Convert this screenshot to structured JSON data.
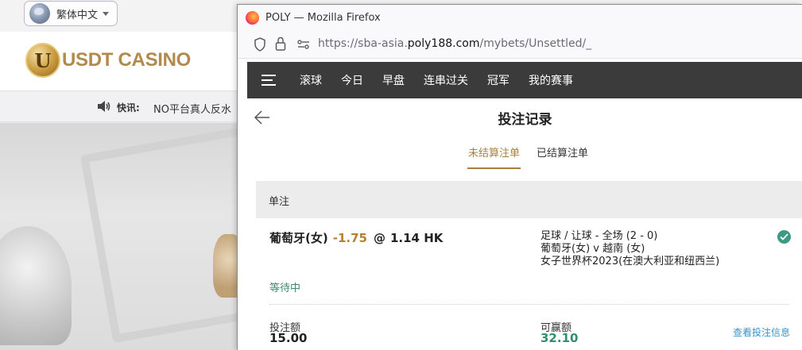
{
  "background_site": {
    "language_selector": {
      "label": "繁体中文",
      "icon": "globe-icon"
    },
    "logo": {
      "mark": "U",
      "text": "USDT CASINO"
    },
    "news": {
      "label": "快讯:",
      "text": "NO平台真人反水",
      "icon": "speaker-icon"
    }
  },
  "browser": {
    "window_title": "POLY — Mozilla Firefox",
    "url": {
      "prefix": "https://sba-asia.",
      "domain": "poly188.com",
      "path": "/mybets/Unsettled/_"
    }
  },
  "sports_nav": {
    "items": [
      {
        "label": "滚球"
      },
      {
        "label": "今日"
      },
      {
        "label": "早盘"
      },
      {
        "label": "连串过关"
      },
      {
        "label": "冠军"
      },
      {
        "label": "我的赛事"
      }
    ]
  },
  "page": {
    "title": "投注记录",
    "tabs": [
      {
        "label": "未结算注单",
        "active": true
      },
      {
        "label": "已结算注单",
        "active": false
      }
    ],
    "section_label": "单注"
  },
  "bet": {
    "selection": "葡萄牙(女)",
    "handicap": "-1.75",
    "at_symbol": "@",
    "odds": "1.14 HK",
    "market": "足球 / 让球 - 全场 (2 - 0)",
    "match": "葡萄牙(女) v 越南 (女)",
    "league": "女子世界杯2023(在澳大利亚和纽西兰)",
    "status": "等待中",
    "stake_label": "投注额",
    "stake_value": "15.00",
    "win_label": "可赢额",
    "win_value": "32.10",
    "view_link": "查看投注信息"
  },
  "colors": {
    "accent_gold": "#a6813d",
    "handicap_orange": "#b6812e",
    "win_green": "#2f8f6f",
    "link_blue": "#3a93c9",
    "nav_dark": "#3b3b3b"
  }
}
